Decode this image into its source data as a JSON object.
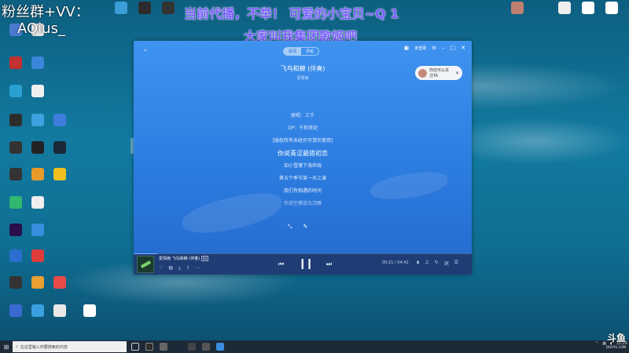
{
  "overlay": {
    "fans_text": "粉丝群+VV：",
    "name_text": "AQius_",
    "top_text": "当前代播，不举！    可爱的小宝贝~Q  1",
    "sub_text": "大家叫我集团歌姬吧"
  },
  "player": {
    "seg_tabs": [
      "歌词",
      "评论"
    ],
    "login_text": "未登录",
    "song_title": "飞鸟和蝉 (伴奏)",
    "song_artist": "爱情雨",
    "follow_text": "你还可以关注TA",
    "lyrics": [
      {
        "text": "原唱：三千",
        "state": "normal"
      },
      {
        "text": "OP：千和世纪",
        "state": "normal"
      },
      {
        "text": "[版权所有未经许可请勿使用]",
        "state": "normal"
      },
      {
        "text": "你说青涩最搭初恋",
        "state": "current"
      },
      {
        "text": "如小雪落下海岸线",
        "state": "normal"
      },
      {
        "text": "第五个季节某一天上演",
        "state": "normal"
      },
      {
        "text": "我们有相遇的时间",
        "state": "normal"
      },
      {
        "text": "你说空捕适合沉睡",
        "state": "dim"
      }
    ],
    "bar": {
      "artist": "爱情雨",
      "title": "飞鸟和蝉 (伴奏)",
      "tag": "SQ",
      "time": "00:21 / 04:42",
      "progress": 0.07
    }
  },
  "taskbar": {
    "search_placeholder": "在这里输入你要搜索的内容",
    "time": "15:29"
  },
  "watermark": {
    "text": "斗鱼",
    "url": "DOUYU.COM"
  },
  "colors": {
    "player_bg": "#3f93ef",
    "player_bar": "#1f3c74",
    "overlay_purple": "#7b5cff"
  }
}
